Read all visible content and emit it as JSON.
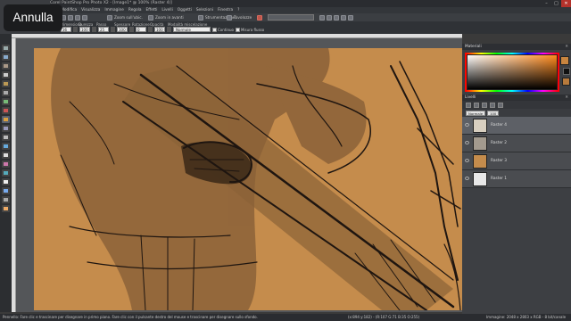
{
  "window": {
    "title": "Corel PaintShop Pro Photo X2 - [Image1* @ 100% (Raster 4)]",
    "controls": [
      "–",
      "□",
      "✕"
    ]
  },
  "menu": [
    "File",
    "Modifica",
    "Visualizza",
    "Immagine",
    "Regola",
    "Effetti",
    "Livelli",
    "Oggetti",
    "Selezioni",
    "Finestra",
    "?"
  ],
  "toolbar": {
    "zoom_label": "Zoom sull'ubic.",
    "zoom2_label": "Zoom in avanti",
    "view_label": "Strumentazione",
    "work_label": "Tavolozze"
  },
  "options": {
    "labels": [
      "Dimensione",
      "Durezza",
      "Passo",
      "Spessore",
      "Rotazione",
      "Opacità",
      "Modalità miscelazione"
    ],
    "values": [
      "36",
      "100",
      "25",
      "100",
      "0",
      "100"
    ],
    "blend_mode": "Normale",
    "checks": [
      "Continuo",
      "Misura flusso"
    ]
  },
  "annulla": {
    "label": "Annulla"
  },
  "materials_panel": {
    "title": "Materiali",
    "colors": {
      "foreground": "#c9853f",
      "background": "#111111"
    }
  },
  "layers_panel": {
    "title": "Livelli",
    "blend_mode": "Normale",
    "opacity": "100",
    "layers": [
      {
        "name": "Raster 4",
        "active": true
      },
      {
        "name": "Raster 2",
        "active": false
      },
      {
        "name": "Raster 3",
        "active": false
      },
      {
        "name": "Raster 1",
        "active": false
      }
    ]
  },
  "status": {
    "left": "Pennello: Fare clic e trascinare per disegnare in primo piano. Fare clic con il pulsante destro del mouse e trascinare per disegnare sullo sfondo.",
    "mid": "(x:894 y:182) - (R:107 G:71 B:35 O:255)",
    "right": "Immagine: 2048 x 2803 x RGB - 8 bit/canale"
  },
  "canvas_colors": {
    "paper": "#c58c4c",
    "shade": "#6b4a2e",
    "line": "#1e1510"
  }
}
